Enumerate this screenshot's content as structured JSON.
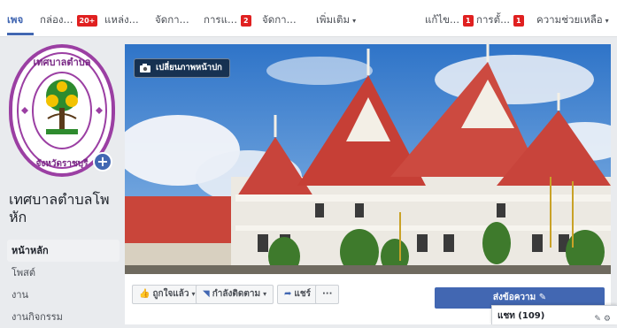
{
  "topnav": {
    "items": [
      {
        "label": "เพจ",
        "badge": ""
      },
      {
        "label": "กล่อง...",
        "badge": "20+"
      },
      {
        "label": "แหล่ง...",
        "badge": ""
      },
      {
        "label": "จัดกา...",
        "badge": ""
      },
      {
        "label": "การแ...",
        "badge": "2"
      },
      {
        "label": "จัดกา...",
        "badge": ""
      },
      {
        "label": "เพิ่มเติม",
        "badge": ""
      }
    ],
    "right_items": [
      {
        "label": "แก้ไข...",
        "badge": "1"
      },
      {
        "label": "การตั้...",
        "badge": "1"
      },
      {
        "label": "ความช่วยเหลือ",
        "badge": ""
      }
    ]
  },
  "profile": {
    "logo_text": "เทศบาลตำบลโพหัก จังหวัดราชบุรี",
    "name": "เทศบาลตำบลโพหัก"
  },
  "sidebar": {
    "items": [
      "หน้าหลัก",
      "โพสต์",
      "งาน",
      "งานกิจกรรม"
    ]
  },
  "cover": {
    "change_label": "เปลี่ยนภาพหน้าปก"
  },
  "actions": {
    "like": "ถูกใจแล้ว",
    "follow": "กำลังติดตาม",
    "share": "แชร์",
    "more": "···",
    "send": "ส่งข้อความ"
  },
  "chat": {
    "label": "แชท (109)"
  },
  "colors": {
    "accent": "#4267b2",
    "badge": "#e02020",
    "logo_ring": "#9b3fa3"
  }
}
